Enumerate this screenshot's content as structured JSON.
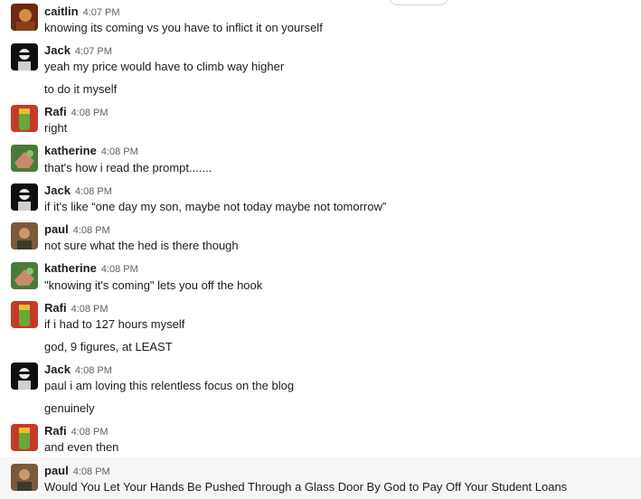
{
  "messages": [
    {
      "id": "m1",
      "user": "caitlin",
      "time": "4:07 PM",
      "avatar": "caitlin",
      "lines": [
        "knowing its coming vs you have to inflict it on yourself"
      ]
    },
    {
      "id": "m2",
      "user": "Jack",
      "time": "4:07 PM",
      "avatar": "jack",
      "lines": [
        "yeah my price would have to climb way higher",
        "to do it myself"
      ]
    },
    {
      "id": "m3",
      "user": "Rafi",
      "time": "4:08 PM",
      "avatar": "rafi",
      "lines": [
        "right"
      ]
    },
    {
      "id": "m4",
      "user": "katherine",
      "time": "4:08 PM",
      "avatar": "katherine",
      "lines": [
        "that's how i read the prompt......."
      ]
    },
    {
      "id": "m5",
      "user": "Jack",
      "time": "4:08 PM",
      "avatar": "jack",
      "lines": [
        "if it's like “one day my son, maybe not today maybe not tomorrow”"
      ]
    },
    {
      "id": "m6",
      "user": "paul",
      "time": "4:08 PM",
      "avatar": "paul",
      "lines": [
        "not sure what the hed is there though"
      ]
    },
    {
      "id": "m7",
      "user": "katherine",
      "time": "4:08 PM",
      "avatar": "katherine",
      "lines": [
        "\"knowing it's coming\" lets you off the hook"
      ]
    },
    {
      "id": "m8",
      "user": "Rafi",
      "time": "4:08 PM",
      "avatar": "rafi",
      "lines": [
        "if i had to 127 hours myself",
        "god, 9 figures, at LEAST"
      ]
    },
    {
      "id": "m9",
      "user": "Jack",
      "time": "4:08 PM",
      "avatar": "jack",
      "lines": [
        "paul i am loving this relentless focus on the blog",
        "genuinely"
      ]
    },
    {
      "id": "m10",
      "user": "Rafi",
      "time": "4:08 PM",
      "avatar": "rafi",
      "lines": [
        "and even then"
      ]
    },
    {
      "id": "m11",
      "user": "paul",
      "time": "4:08 PM",
      "avatar": "paul",
      "lines": [
        "Would You Let Your Hands Be Pushed Through a Glass Door By God to Pay Off Your Student Loans"
      ]
    }
  ],
  "colors": {
    "text": "#1d1c1d",
    "timestamp": "#616061",
    "hover_background": "#f6f6f6"
  }
}
